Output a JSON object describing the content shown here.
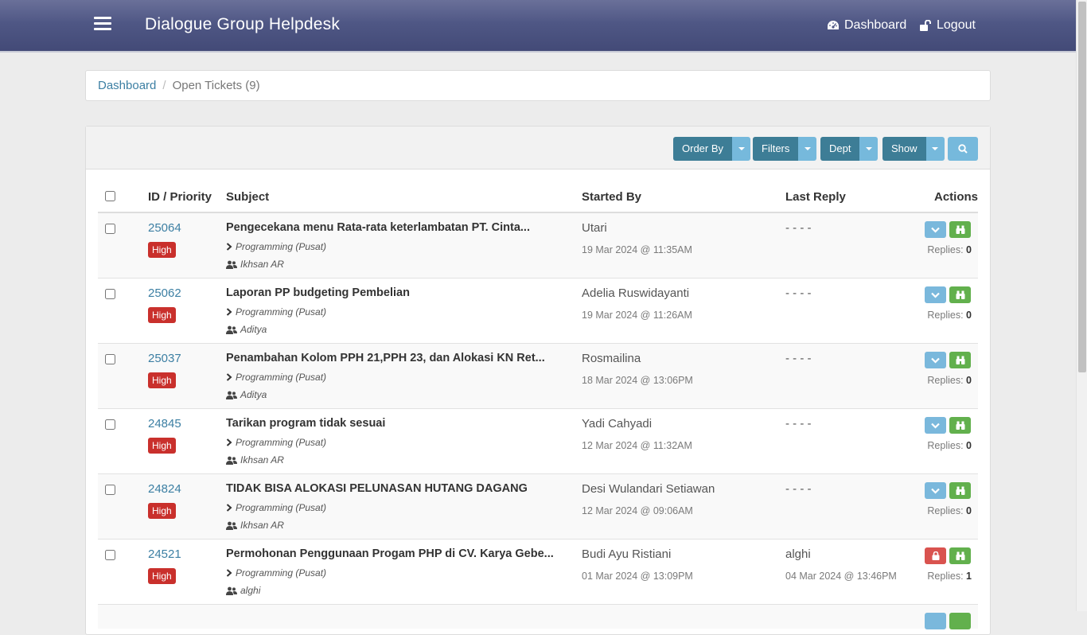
{
  "header": {
    "brand": "Dialogue Group Helpdesk",
    "dashboard_label": "Dashboard",
    "logout_label": "Logout"
  },
  "breadcrumb": {
    "home": "Dashboard",
    "current": "Open Tickets (9)"
  },
  "toolbar": {
    "order_by": "Order By",
    "filters": "Filters",
    "dept": "Dept",
    "show": "Show"
  },
  "table": {
    "columns": {
      "id_priority": "ID / Priority",
      "subject": "Subject",
      "started_by": "Started By",
      "last_reply": "Last Reply",
      "actions": "Actions"
    },
    "replies_label": "Replies:",
    "rows": [
      {
        "id": "25064",
        "priority": "High",
        "subject": "Pengecekana menu Rata-rata keterlambatan PT. Cinta...",
        "dept": "Programming (Pusat)",
        "assignee": "Ikhsan AR",
        "started_by": "Utari",
        "started_date": "19 Mar 2024 @ 11:35AM",
        "last_reply": "- - - -",
        "last_reply_date": "",
        "locked": false,
        "replies": "0"
      },
      {
        "id": "25062",
        "priority": "High",
        "subject": "Laporan PP budgeting Pembelian",
        "dept": "Programming (Pusat)",
        "assignee": "Aditya",
        "started_by": "Adelia Ruswidayanti",
        "started_date": "19 Mar 2024 @ 11:26AM",
        "last_reply": "- - - -",
        "last_reply_date": "",
        "locked": false,
        "replies": "0"
      },
      {
        "id": "25037",
        "priority": "High",
        "subject": "Penambahan Kolom PPH 21,PPH 23, dan Alokasi KN Ret...",
        "dept": "Programming (Pusat)",
        "assignee": "Aditya",
        "started_by": "Rosmailina",
        "started_date": "18 Mar 2024 @ 13:06PM",
        "last_reply": "- - - -",
        "last_reply_date": "",
        "locked": false,
        "replies": "0"
      },
      {
        "id": "24845",
        "priority": "High",
        "subject": "Tarikan program tidak sesuai",
        "dept": "Programming (Pusat)",
        "assignee": "Ikhsan AR",
        "started_by": "Yadi Cahyadi",
        "started_date": "12 Mar 2024 @ 11:32AM",
        "last_reply": "- - - -",
        "last_reply_date": "",
        "locked": false,
        "replies": "0"
      },
      {
        "id": "24824",
        "priority": "High",
        "subject": "TIDAK BISA ALOKASI PELUNASAN HUTANG DAGANG",
        "dept": "Programming (Pusat)",
        "assignee": "Ikhsan AR",
        "started_by": "Desi Wulandari Setiawan",
        "started_date": "12 Mar 2024 @ 09:06AM",
        "last_reply": "- - - -",
        "last_reply_date": "",
        "locked": false,
        "replies": "0"
      },
      {
        "id": "24521",
        "priority": "High",
        "subject": "Permohonan Penggunaan Progam PHP di CV. Karya Gebe...",
        "dept": "Programming (Pusat)",
        "assignee": "alghi",
        "started_by": "Budi Ayu Ristiani",
        "started_date": "01 Mar 2024 @ 13:09PM",
        "last_reply": "alghi",
        "last_reply_date": "04 Mar 2024 @ 13:46PM",
        "locked": true,
        "replies": "1"
      },
      {
        "id": "",
        "priority": "",
        "subject": "",
        "dept": "",
        "assignee": "",
        "started_by": "",
        "started_date": "",
        "last_reply": "",
        "last_reply_date": "",
        "locked": false,
        "replies": ""
      }
    ]
  },
  "icons": {
    "menu": "hamburger-icon",
    "dashboard": "tachometer-icon",
    "logout": "unlock-icon",
    "search": "search-icon",
    "dept": "chevron-right-icon",
    "assignee": "users-icon",
    "expand": "chevron-down-icon",
    "view": "binoculars-icon",
    "locked": "lock-icon"
  },
  "colors": {
    "navbar": "#4f5785",
    "link": "#3c7fa3",
    "priority_high": "#c9302c",
    "btn_primary": "#3d7d96",
    "btn_info": "#76b9dc",
    "btn_success": "#62b04d",
    "btn_danger": "#d9534f"
  }
}
